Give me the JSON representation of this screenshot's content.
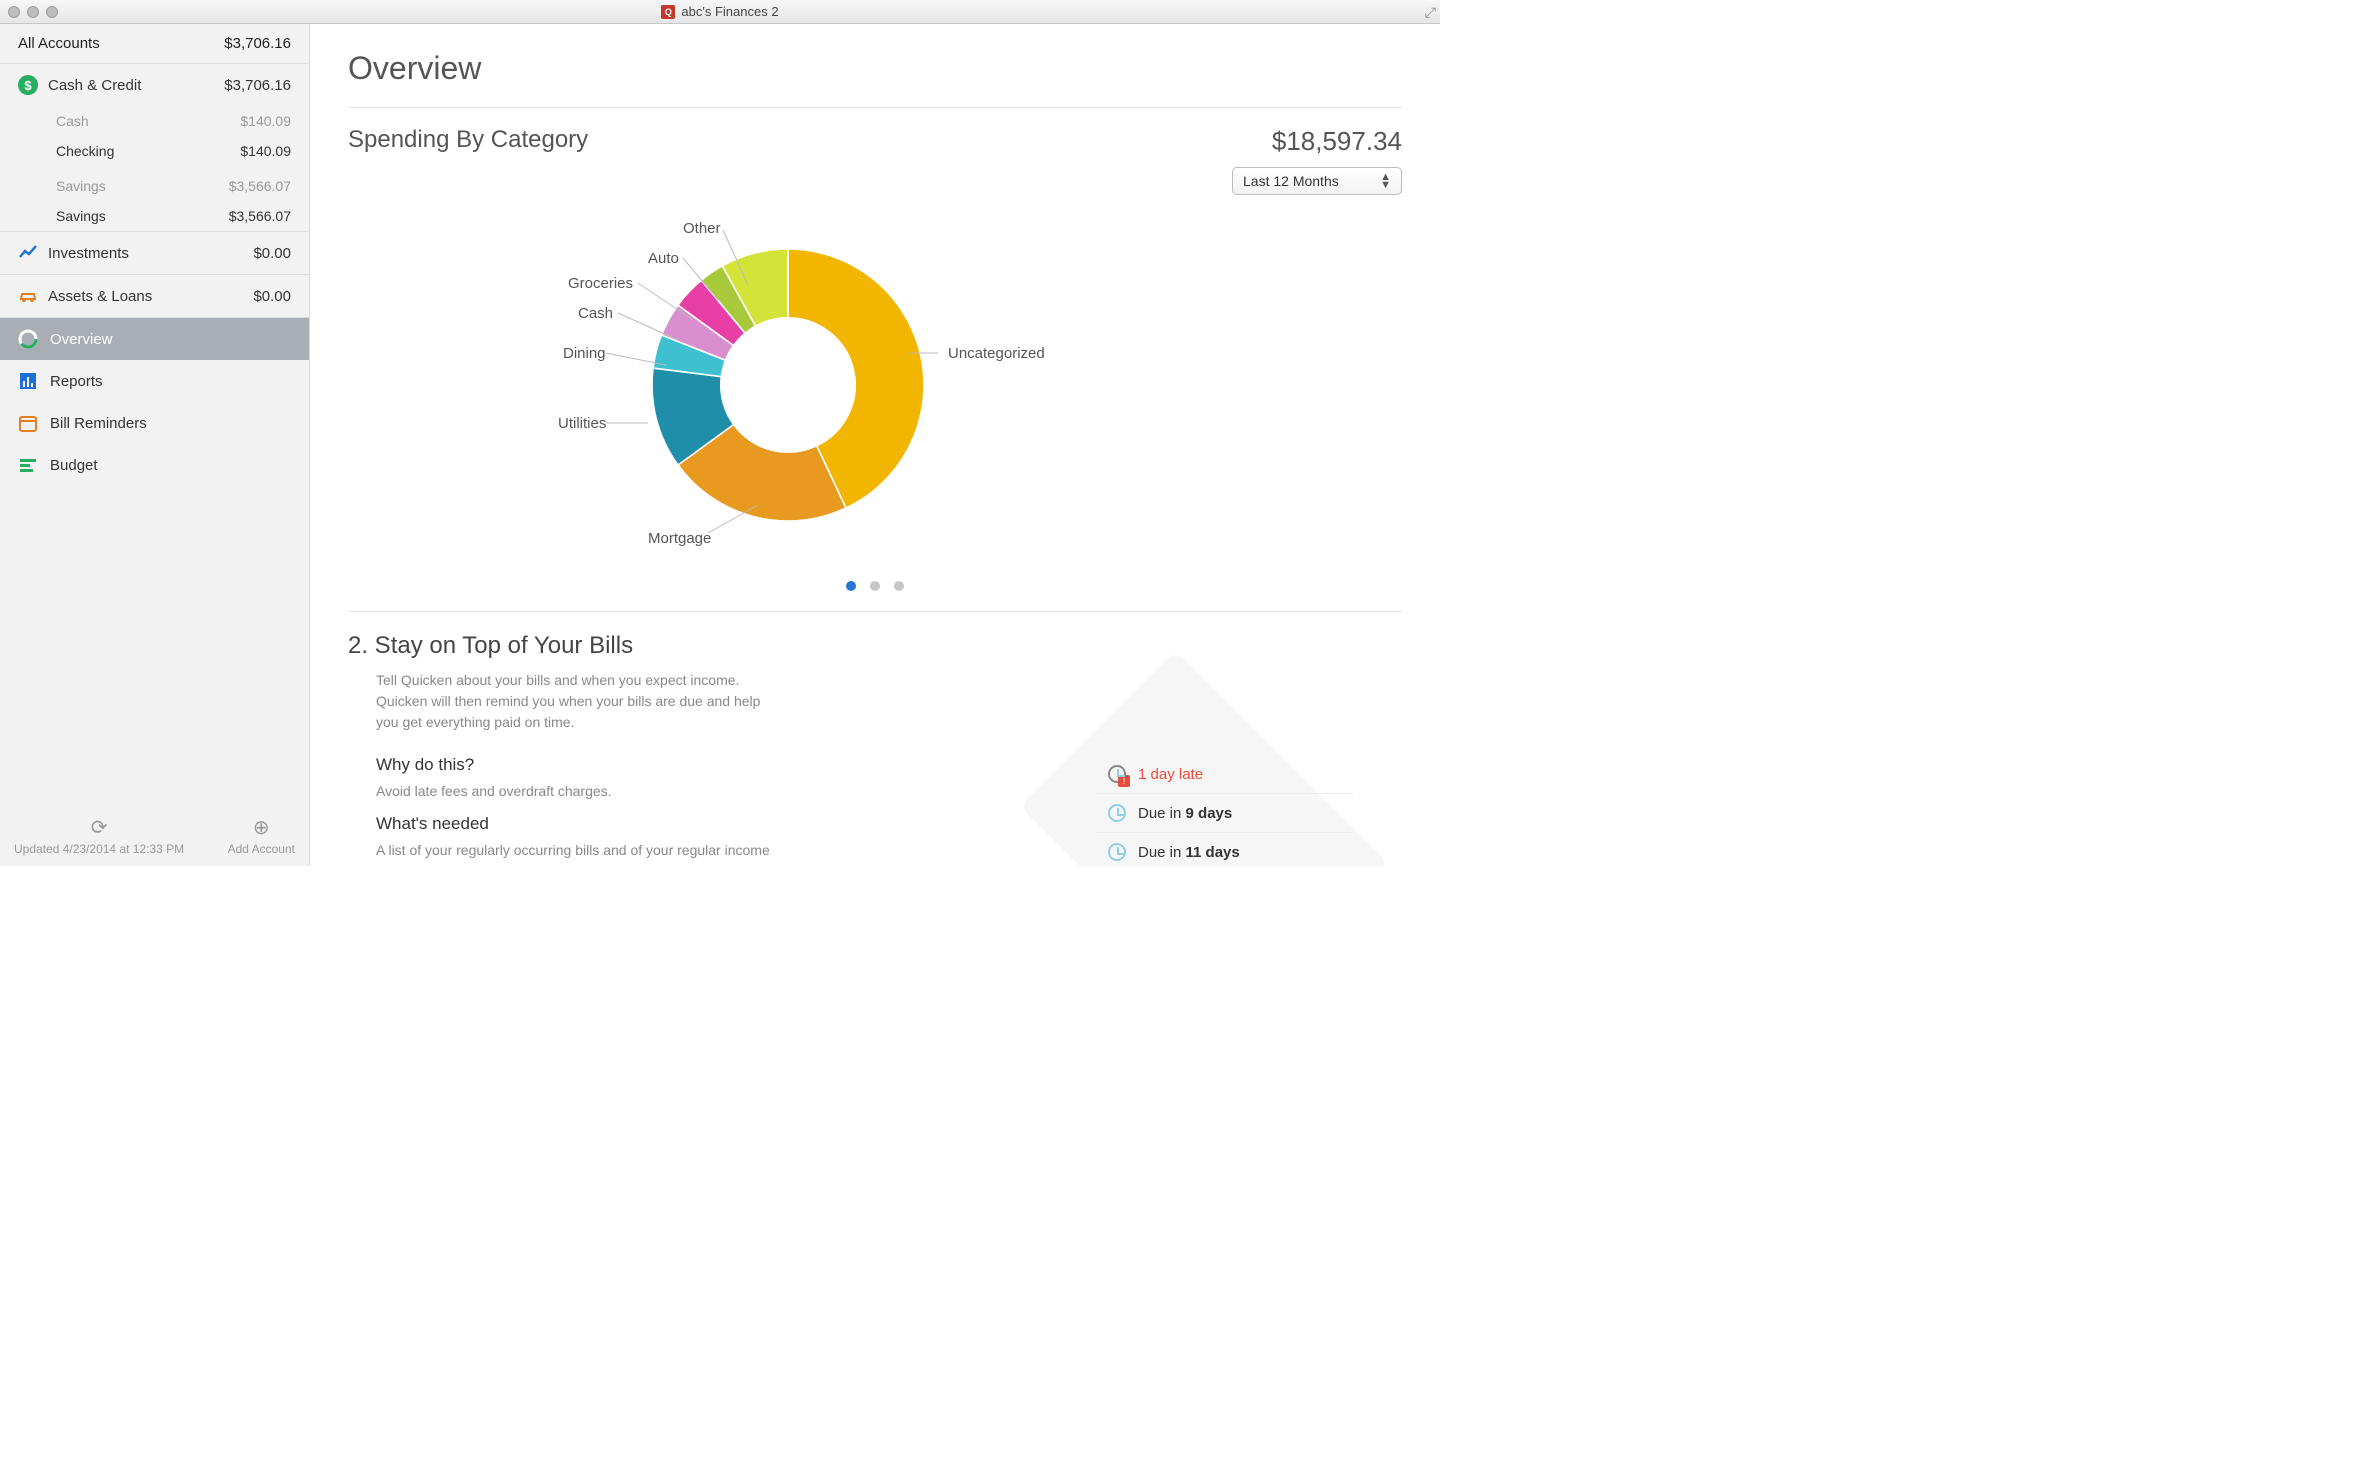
{
  "window": {
    "title": "abc's Finances 2"
  },
  "sidebar": {
    "all_accounts_label": "All Accounts",
    "all_accounts_amount": "$3,706.16",
    "cash_credit_label": "Cash & Credit",
    "cash_credit_amount": "$3,706.16",
    "cash_group_label": "Cash",
    "cash_group_amount": "$140.09",
    "checking_label": "Checking",
    "checking_amount": "$140.09",
    "savings_group_label": "Savings",
    "savings_group_amount": "$3,566.07",
    "savings_label": "Savings",
    "savings_amount": "$3,566.07",
    "investments_label": "Investments",
    "investments_amount": "$0.00",
    "assets_label": "Assets & Loans",
    "assets_amount": "$0.00",
    "nav": {
      "overview": "Overview",
      "reports": "Reports",
      "reminders": "Bill Reminders",
      "budget": "Budget"
    },
    "footer": {
      "updated": "Updated 4/23/2014 at 12:33 PM",
      "add_account": "Add Account"
    }
  },
  "overview": {
    "title": "Overview",
    "section_title": "Spending By Category",
    "total": "$18,597.34",
    "period": "Last 12 Months",
    "labels": {
      "uncategorized": "Uncategorized",
      "mortgage": "Mortgage",
      "utilities": "Utilities",
      "dining": "Dining",
      "cash": "Cash",
      "groceries": "Groceries",
      "auto": "Auto",
      "other": "Other"
    }
  },
  "chart_data": {
    "type": "pie",
    "title": "Spending By Category",
    "total": 18597.34,
    "period": "Last 12 Months",
    "series": [
      {
        "name": "Uncategorized",
        "value": 7995,
        "color": "#f2b500"
      },
      {
        "name": "Mortgage",
        "value": 4091,
        "color": "#e79a1f"
      },
      {
        "name": "Utilities",
        "value": 2232,
        "color": "#1f8ea8"
      },
      {
        "name": "Dining",
        "value": 744,
        "color": "#3fc0d1"
      },
      {
        "name": "Cash",
        "value": 744,
        "color": "#d98fce"
      },
      {
        "name": "Groceries",
        "value": 744,
        "color": "#e83fa6"
      },
      {
        "name": "Auto",
        "value": 558,
        "color": "#a8c93a"
      },
      {
        "name": "Other",
        "value": 1489,
        "color": "#d4e337"
      }
    ]
  },
  "bills_section": {
    "heading": "2. Stay on Top of Your Bills",
    "description": "Tell Quicken about your bills and when you expect income. Quicken will then remind you when your bills are due and help you get everything paid on time.",
    "why_h": "Why do this?",
    "why_p": "Avoid late fees and overdraft charges.",
    "need_h": "What's needed",
    "need_p": "A list of your regularly occurring bills and of your regular income (like your paycheck).",
    "rows": {
      "late_text": "1 day late",
      "due9_prefix": "Due in ",
      "due9_days": "9 days",
      "due11_prefix": "Due in ",
      "due11_days": "11 days"
    }
  }
}
